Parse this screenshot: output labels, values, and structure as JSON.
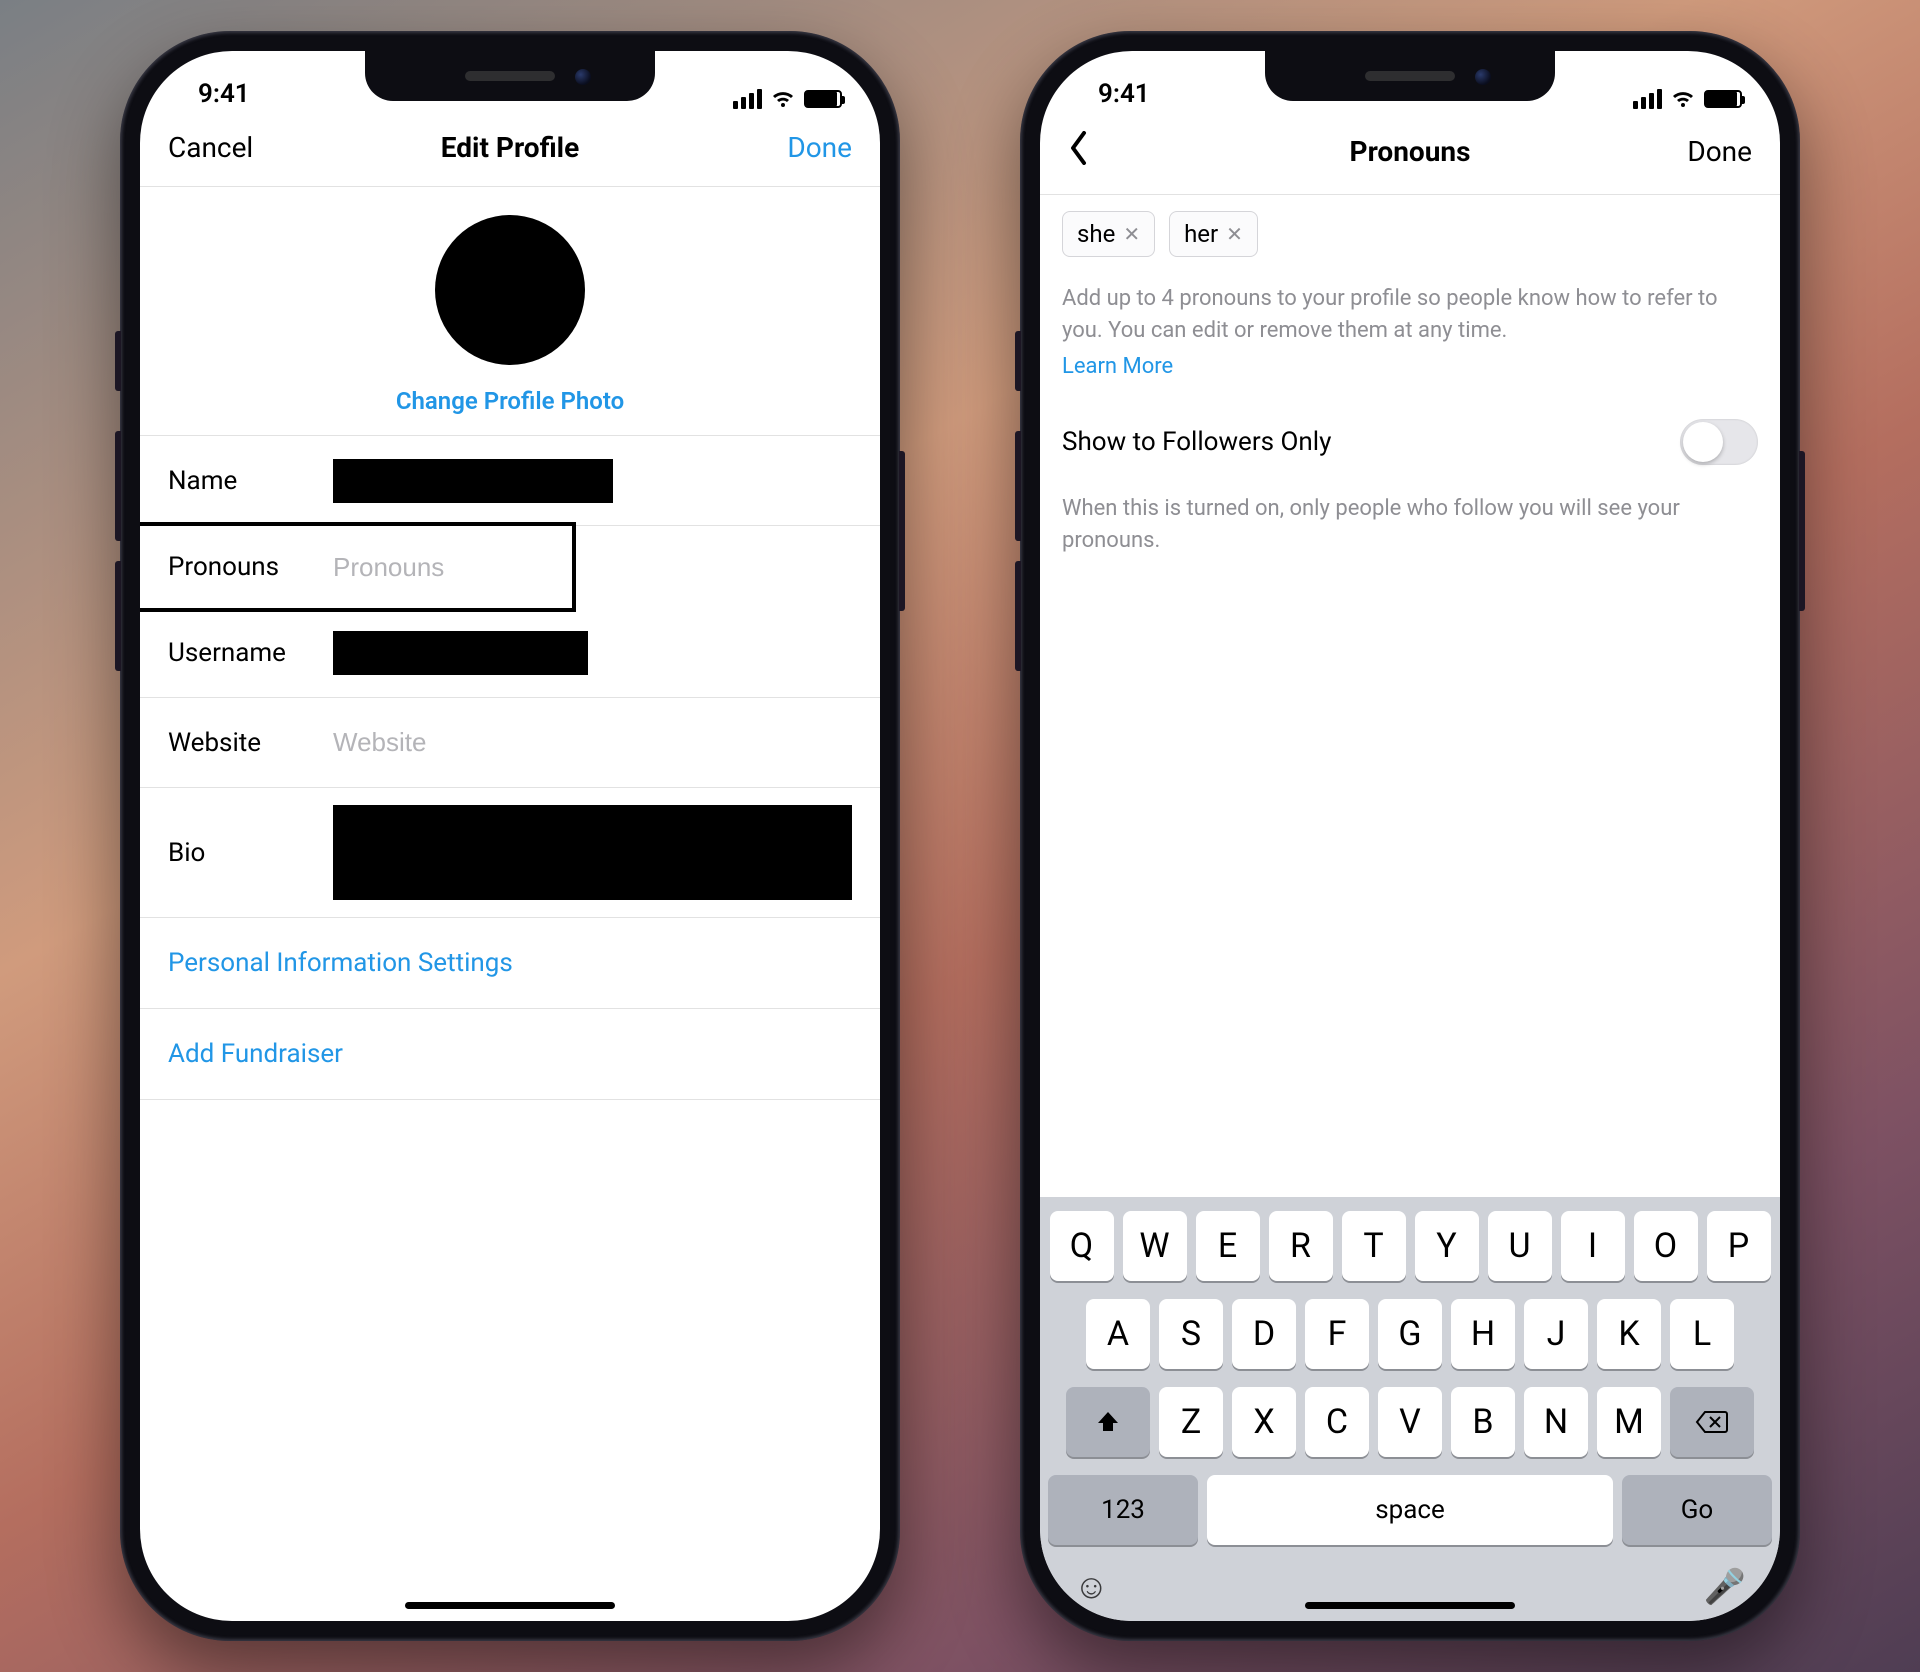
{
  "status": {
    "time": "9:41"
  },
  "left_phone": {
    "nav": {
      "cancel": "Cancel",
      "title": "Edit Profile",
      "done": "Done"
    },
    "change_photo": "Change Profile Photo",
    "fields": {
      "name_label": "Name",
      "pronouns_label": "Pronouns",
      "pronouns_placeholder": "Pronouns",
      "username_label": "Username",
      "website_label": "Website",
      "website_placeholder": "Website",
      "bio_label": "Bio"
    },
    "links": {
      "personal_info": "Personal Information Settings",
      "add_fundraiser": "Add Fundraiser"
    }
  },
  "right_phone": {
    "nav": {
      "title": "Pronouns",
      "done": "Done"
    },
    "chips": [
      "she",
      "her"
    ],
    "helper": "Add up to 4 pronouns to your profile so people know how to refer to you. You can edit or remove them at any time.",
    "learn_more": "Learn More",
    "toggle_label": "Show to Followers Only",
    "toggle_helper": "When this is turned on, only people who follow you will see your pronouns.",
    "keyboard": {
      "row1": [
        "Q",
        "W",
        "E",
        "R",
        "T",
        "Y",
        "U",
        "I",
        "O",
        "P"
      ],
      "row2": [
        "A",
        "S",
        "D",
        "F",
        "G",
        "H",
        "J",
        "K",
        "L"
      ],
      "row3": [
        "Z",
        "X",
        "C",
        "V",
        "B",
        "N",
        "M"
      ],
      "num": "123",
      "space": "space",
      "go": "Go"
    }
  }
}
